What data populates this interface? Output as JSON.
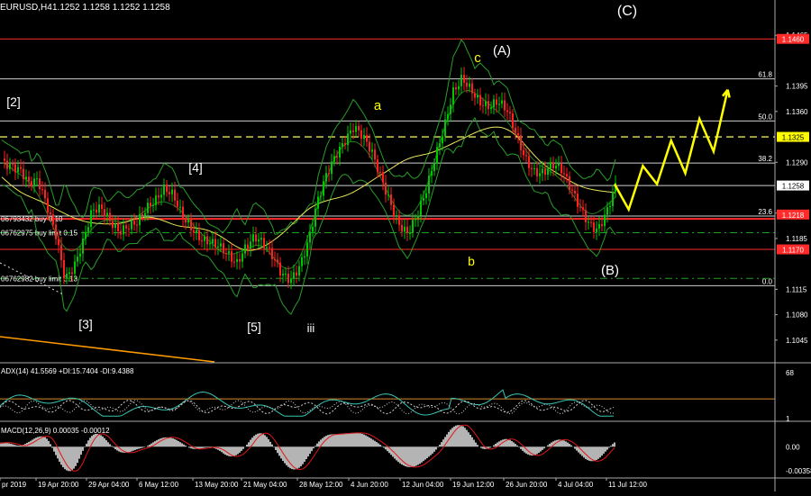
{
  "header": {
    "symbol": "EURUSD,H4",
    "ohlc": "1.1252 1.1258 1.1252 1.1258"
  },
  "colors": {
    "background": "#000000",
    "candle_bull": "#00c800",
    "candle_bear": "#ff2020",
    "bands": "#2a9d2a",
    "ma": "#e6e65a",
    "projection": "#ffff00",
    "red_line": "#ff2a2a",
    "buy_limit_lines": "#1fa11f",
    "adx_main": "#38c4b4",
    "adx_di": "#d0d0d0",
    "adx_level": "#d98a2b",
    "macd_hist": "#b4b4b4",
    "macd_signal": "#e01818",
    "trendline": "#ff9a00"
  },
  "chart_data": [
    {
      "type": "line",
      "title": "EURUSD,H4",
      "ylim": [
        1.1015,
        1.1495
      ],
      "y_ticks": [
        "1.1465",
        "1.1395",
        "1.1360",
        "1.1290",
        "1.1220",
        "1.1185",
        "1.1115",
        "1.1080",
        "1.1045"
      ],
      "highlighted_prices": [
        {
          "label": "1.1460",
          "value": 1.146
        },
        {
          "label": "1.1325",
          "value": 1.1325
        },
        {
          "label": "1.1258",
          "value": 1.1258
        },
        {
          "label": "1.1218",
          "value": 1.1218
        },
        {
          "label": "1.1170",
          "value": 1.117
        }
      ],
      "fibonacci_levels": [
        {
          "label": "61.8",
          "value": 1.1405
        },
        {
          "label": "50.0",
          "value": 1.1347
        },
        {
          "label": "38.2",
          "value": 1.1289
        },
        {
          "label": "23.6",
          "value": 1.1216
        },
        {
          "label": "0.0",
          "value": 1.112
        }
      ],
      "order_lines": [
        {
          "label": "06793432 buy 0.10",
          "value": 1.1212
        },
        {
          "label": "06762975 buy limit 0.15",
          "value": 1.1193
        },
        {
          "label": "06762982 buy limit 0.13",
          "value": 1.113
        }
      ],
      "wave_labels": [
        "(C)",
        "(A)",
        "c",
        "a",
        "[2]",
        "[4]",
        "(B)",
        "b",
        "[3]",
        "[5]",
        "iii"
      ],
      "x_ticks": [
        "pr 2019",
        "19 Apr 20:00",
        "29 Apr 04:00",
        "6 May 12:00",
        "13 May 20:00",
        "21 May 04:00",
        "28 May 12:00",
        "4 Jun 20:00",
        "12 Jun 04:00",
        "19 Jun 12:00",
        "26 Jun 20:00",
        "4 Jul 04:00",
        "11 Jul 12:00"
      ],
      "close_path": [
        1.1295,
        1.1285,
        1.1275,
        1.1255,
        1.1262,
        1.1232,
        1.1195,
        1.1135,
        1.1148,
        1.1178,
        1.1218,
        1.1222,
        1.1208,
        1.1198,
        1.1208,
        1.1212,
        1.1226,
        1.1232,
        1.1248,
        1.1242,
        1.1218,
        1.1205,
        1.119,
        1.1182,
        1.1172,
        1.1158,
        1.1145,
        1.1172,
        1.1192,
        1.1185,
        1.1165,
        1.1135,
        1.1122,
        1.114,
        1.118,
        1.124,
        1.128,
        1.1305,
        1.132,
        1.1335,
        1.132,
        1.13,
        1.127,
        1.124,
        1.121,
        1.1195,
        1.1215,
        1.1245,
        1.129,
        1.1335,
        1.139,
        1.1412,
        1.1395,
        1.1372,
        1.1362,
        1.1368,
        1.1358,
        1.133,
        1.13,
        1.1282,
        1.1278,
        1.1285,
        1.1275,
        1.125,
        1.1228,
        1.121,
        1.1202,
        1.1225,
        1.1258
      ],
      "projection_path": [
        1.126,
        1.1225,
        1.1285,
        1.126,
        1.132,
        1.1275,
        1.135,
        1.1305,
        1.139
      ]
    },
    {
      "type": "line",
      "title": "ADX(14) 41.5569 +DI:15.7404 -DI:9.4388",
      "ylim": [
        0,
        80
      ],
      "y_ticks": [
        "68",
        "1"
      ],
      "level": 30
    },
    {
      "type": "bar",
      "title": "MACD(12,26,9) 0.00035 -0.00012",
      "ylim": [
        -0.0045,
        0.0035
      ],
      "y_ticks": [
        "0.00",
        "-0.00358"
      ]
    }
  ]
}
